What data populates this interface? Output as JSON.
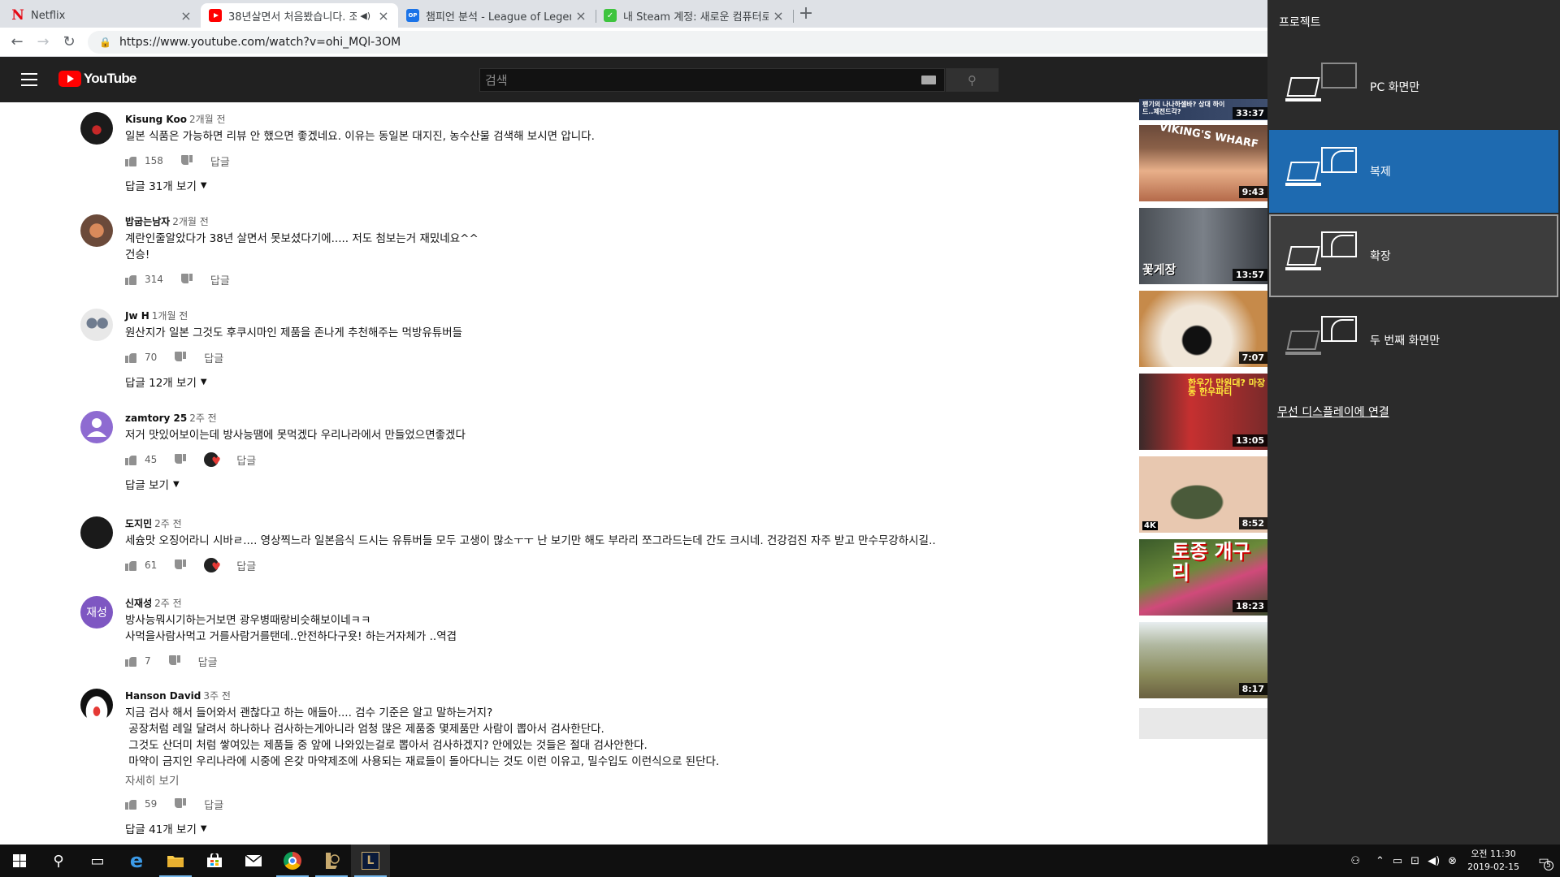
{
  "tabs": [
    {
      "title": "Netflix",
      "favicon": "N"
    },
    {
      "title": "38년살면서 처음봤습니다. 조",
      "favicon": "youtube-icon"
    },
    {
      "title": "챔피언 분석 - League of Legends",
      "favicon": "op.gg"
    },
    {
      "title": "내 Steam 계정: 새로운 컴퓨터로",
      "favicon": "steam-guard-icon"
    }
  ],
  "address": {
    "url": "https://www.youtube.com/watch?v=ohi_MQl-3OM"
  },
  "youtube": {
    "logo_text": "YouTube",
    "search_placeholder": "검색"
  },
  "comments": [
    {
      "author": "Kisung Koo",
      "time": "2개월 전",
      "lines": [
        "일본 식품은 가능하면 리뷰 안 했으면 좋겠네요. 이유는 동일본 대지진, 농수산물 검색해 보시면 압니다."
      ],
      "likes": "158",
      "reply": "답글",
      "view_replies": "답글 31개 보기"
    },
    {
      "author": "밥굽는남자",
      "time": "2개월 전",
      "lines": [
        "계란인줄알았다가 38년 살면서 못보셨다기에..... 저도 첨보는거 재밌네요^^",
        "건승!"
      ],
      "likes": "314",
      "reply": "답글"
    },
    {
      "author": "Jw H",
      "time": "1개월 전",
      "lines": [
        "원산지가 일본 그것도 후쿠시마인 제품을 존나게 추천해주는 먹방유튜버들"
      ],
      "likes": "70",
      "reply": "답글",
      "view_replies": "답글 12개 보기"
    },
    {
      "author": "zamtory 25",
      "time": "2주 전",
      "lines": [
        "저거 맛있어보이는데 방사능땜에 못먹겠다 우리나라에서 만들었으면좋겠다"
      ],
      "likes": "45",
      "reply": "답글",
      "view_replies": "답글 보기"
    },
    {
      "author": "도지민",
      "time": "2주 전",
      "lines": [
        "세슘맛 오징어라니 시바ㄹ.... 영상찍느라 일본음식 드시는 유튜버들 모두 고생이 많소ㅜㅜ 난 보기만 해도 부라리 쪼그라드는데 간도 크시네. 건강검진 자주 받고 만수무강하시길.."
      ],
      "likes": "61",
      "reply": "답글"
    },
    {
      "author": "신재성",
      "time": "2주 전",
      "avatar_text": "재성",
      "lines": [
        "방사능뭐시기하는거보면 광우병때랑비슷해보이네ㅋㅋ",
        "사먹을사람사먹고 거를사람거를탠데..안전하다구욧! 하는거자체가 ..역겹"
      ],
      "likes": "7",
      "reply": "답글"
    },
    {
      "author": "Hanson David",
      "time": "3주 전",
      "lines": [
        "지금 검사 해서 들어와서 괜찮다고 하는 애들아.... 검수 기준은 알고 말하는거지?",
        " 공장처럼 레일 달려서 하나하나 검사하는게아니라 엄청 많은 제품중 몇제품만 사람이 뽑아서 검사한단다.",
        " 그것도 산더미 처럼 쌓여있는 제품들 중 앞에 나와있는걸로 뽑아서 검사하겠지? 안에있는 것들은 절대 검사안한다.",
        " 마약이 금지인 우리나라에 시중에 온갖 마약제조에 사용되는 재료들이 돌아다니는 것도 이런 이유고, 밀수입도 이런식으로 된단다."
      ],
      "read_more": "자세히 보기",
      "likes": "59",
      "reply": "답글",
      "view_replies": "답글 41개 보기"
    }
  ],
  "thumbnails": [
    {
      "duration": "33:37",
      "caption": "팬기의 나나하셀바? 상대 하이드..제전드각?"
    },
    {
      "duration": "9:43",
      "caption": "VIKING'S WHARF"
    },
    {
      "duration": "13:57",
      "caption": "꽃게장"
    },
    {
      "duration": "7:07",
      "caption": ""
    },
    {
      "duration": "13:05",
      "caption": "한우가 만원대? 마장동 한우파티"
    },
    {
      "duration": "8:52",
      "caption": "4K"
    },
    {
      "duration": "18:23",
      "caption": "토종 개구리"
    },
    {
      "duration": "8:17",
      "caption": ""
    }
  ],
  "project_panel": {
    "title": "프로젝트",
    "options": [
      {
        "label": "PC 화면만",
        "state": "normal"
      },
      {
        "label": "복제",
        "state": "selected"
      },
      {
        "label": "확장",
        "state": "hover"
      },
      {
        "label": "두 번째 화면만",
        "state": "normal"
      }
    ],
    "wireless_link": "무선 디스플레이에 연결",
    "selected_color": "#1e6ab0"
  },
  "taskbar": {
    "apps": [
      "windows-start-icon",
      "search-icon",
      "task-view-icon",
      "edge-icon",
      "file-explorer-icon",
      "store-icon",
      "mail-icon",
      "chrome-icon",
      "lol-icon",
      "league-client-icon"
    ],
    "clock_time": "오전 11:30",
    "clock_date": "2019-02-15",
    "notification_count": "5"
  }
}
